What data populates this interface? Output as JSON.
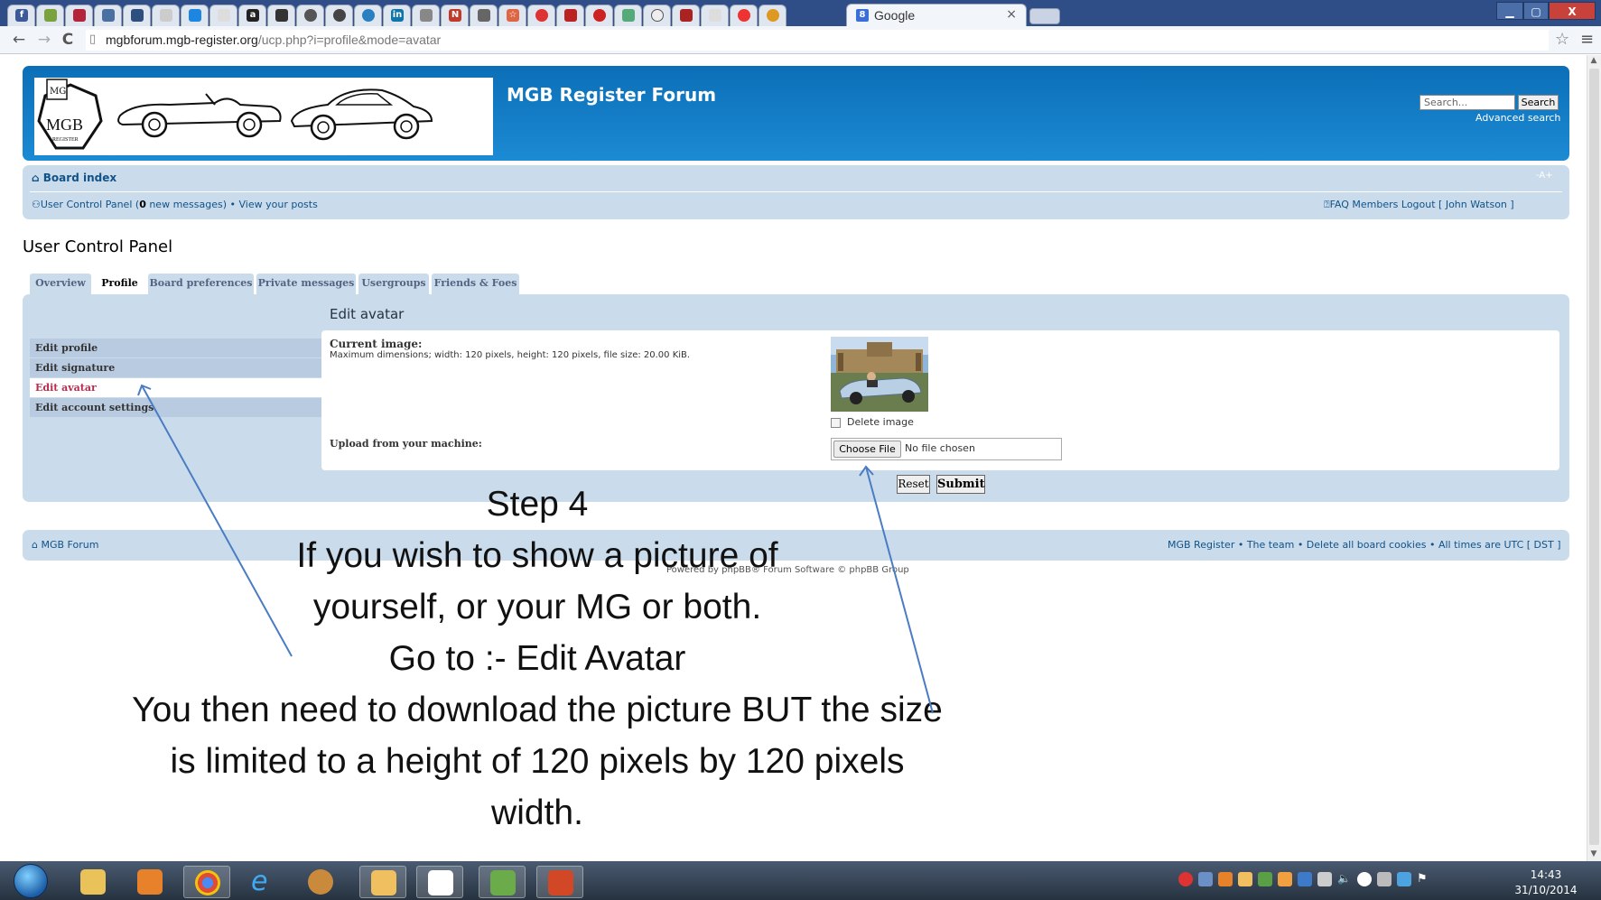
{
  "browser": {
    "active_tab_title": "Google",
    "tab_close": "×",
    "url_host": "mgbforum.mgb-register.org",
    "url_path": "/ucp.php?i=profile&mode=avatar",
    "window_buttons": {
      "min": "▁",
      "max": "▢",
      "close": "X"
    },
    "nav": {
      "back": "←",
      "forward": "→",
      "reload": "C"
    },
    "star": "☆",
    "menu": "≡"
  },
  "forum": {
    "site_title": "MGB Register Forum",
    "search_placeholder": "Search...",
    "search_button": "Search",
    "advanced_search": "Advanced search",
    "logo_text": "MGB",
    "logo_sub": "REGISTER",
    "board_index": "Board index",
    "collapse": "-A+",
    "ucp_link": "User Control Panel",
    "new_messages_count": "0",
    "new_messages_suffix": " new messages) • ",
    "view_posts": "View your posts",
    "right_links": "FAQ  Members  Logout [ John Watson ]",
    "ucp_title": "User Control Panel"
  },
  "tabs": [
    {
      "label": "Overview"
    },
    {
      "label": "Profile"
    },
    {
      "label": "Board preferences"
    },
    {
      "label": "Private messages"
    },
    {
      "label": "Usergroups"
    },
    {
      "label": "Friends & Foes"
    }
  ],
  "sidebar": {
    "items": [
      {
        "label": "Edit profile"
      },
      {
        "label": "Edit signature"
      },
      {
        "label": "Edit avatar"
      },
      {
        "label": "Edit account settings"
      }
    ]
  },
  "avatar_form": {
    "heading": "Edit avatar",
    "current_image_label": "Current image:",
    "current_image_desc": "Maximum dimensions; width: 120 pixels, height: 120 pixels, file size: 20.00 KiB.",
    "delete_label": "Delete image",
    "upload_label": "Upload from your machine:",
    "choose_file": "Choose File",
    "no_file": "No file chosen",
    "reset": "Reset",
    "submit": "Submit"
  },
  "footer": {
    "left": "MGB Forum",
    "right": "MGB Register • The team • Delete all board cookies • All times are UTC [ DST ]",
    "powered": "Powered by phpBB® Forum Software © phpBB Group"
  },
  "annotation": {
    "line1": "Step 4",
    "line2": "If you wish to show a picture of",
    "line3": "yourself, or your MG or both.",
    "line4": "Go to :- Edit Avatar",
    "line5": "You then need to download the picture BUT the size",
    "line6": "is limited to a height of 120 pixels by 120 pixels",
    "line7": "width."
  },
  "taskbar": {
    "time": "14:43",
    "date": "31/10/2014"
  },
  "colors": {
    "header_blue": "#0b6fb7",
    "nav_bg": "#cadceb",
    "link": "#105289",
    "active_side": "#bc2a4d"
  }
}
